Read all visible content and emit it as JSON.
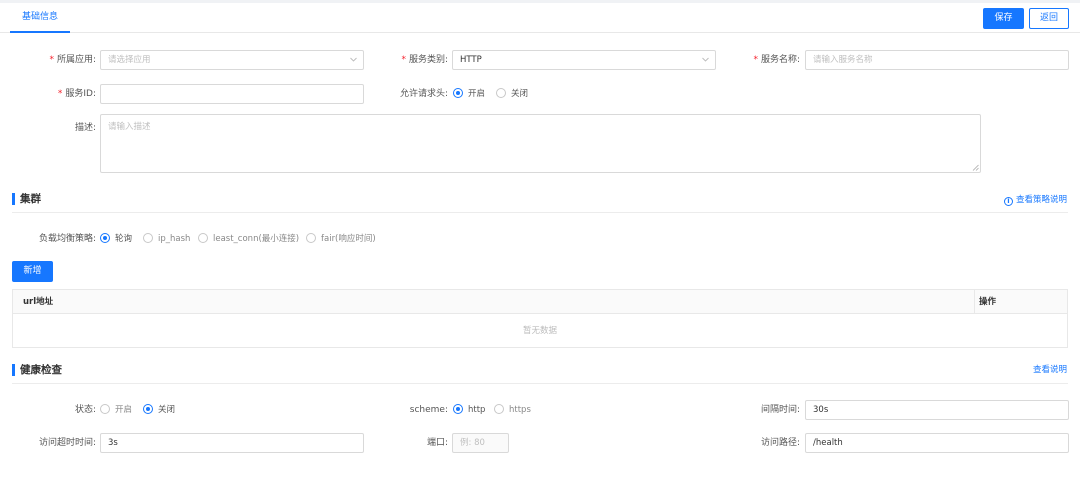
{
  "tabs": [
    {
      "label": "基础信息",
      "active": true
    }
  ],
  "toolbar": {
    "save_label": "保存",
    "back_label": "返回"
  },
  "form": {
    "app": {
      "label": "所属应用:",
      "placeholder": "请选择应用"
    },
    "service_type": {
      "label": "服务类别:",
      "value": "HTTP"
    },
    "service_name": {
      "label": "服务名称:",
      "placeholder": "请输入服务名称"
    },
    "service_id": {
      "label": "服务ID:",
      "value": ""
    },
    "allow_header": {
      "label": "允许请求头:",
      "options": [
        "开启",
        "关闭"
      ],
      "selected": "开启"
    },
    "description": {
      "label": "描述:",
      "placeholder": "请输入描述"
    }
  },
  "cluster": {
    "title": "集群",
    "help_link": "查看策略说明",
    "strategy": {
      "label": "负载均衡策略:",
      "options": [
        "轮询",
        "ip_hash",
        "least_conn(最小连接)",
        "fair(响应时间)"
      ],
      "selected": "轮询"
    },
    "add_button": "新增",
    "table": {
      "columns": [
        "url地址",
        "操作"
      ],
      "rows": [],
      "empty_text": "暂无数据"
    }
  },
  "health": {
    "title": "健康检查",
    "help_link": "查看说明",
    "status": {
      "label": "状态:",
      "options": [
        "开启",
        "关闭"
      ],
      "selected": "关闭"
    },
    "scheme": {
      "label": "scheme:",
      "options": [
        "http",
        "https"
      ],
      "selected": "http"
    },
    "interval": {
      "label": "间隔时间:",
      "value": "30s"
    },
    "timeout": {
      "label": "访问超时时间:",
      "value": "3s"
    },
    "port": {
      "label": "端口:",
      "placeholder": "例: 80"
    },
    "path": {
      "label": "访问路径:",
      "value": "/health"
    }
  },
  "colors": {
    "primary": "#1677ff",
    "required": "#f5222d"
  },
  "icons": [
    "chevron-down-icon",
    "info-circle-icon",
    "resize-grip-icon"
  ]
}
